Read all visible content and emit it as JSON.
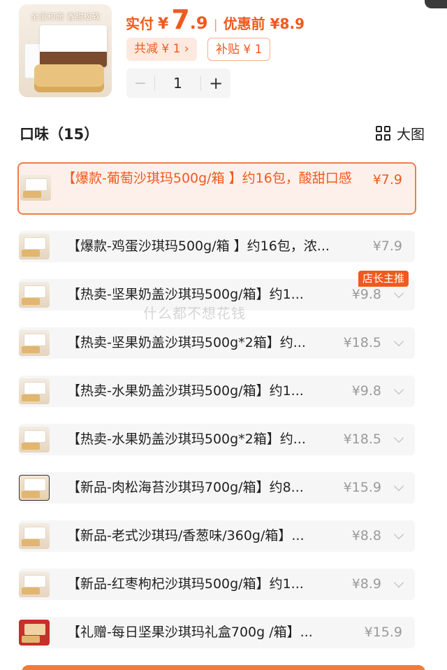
{
  "header": {
    "product_tag": "全蛋和面 香甜松软",
    "price_label": "实付",
    "currency": "¥",
    "price_int": "7",
    "price_dec": ".9",
    "separator": "|",
    "original_price": "优惠前 ¥8.9",
    "discount_chip": "共减 ¥ 1 ›",
    "subsidy_chip": "补贴 ¥ 1",
    "quantity": "1",
    "minus": "−",
    "plus": "+"
  },
  "section": {
    "title": "口味（15）",
    "view_toggle_label": "大图",
    "view_toggle_icon": "grid-icon"
  },
  "badge": "店长主推",
  "watermark": "什么都不想花钱",
  "options": [
    {
      "label": "【爆款-葡萄沙琪玛500g/箱 】约16包，酸甜口感",
      "price": "¥7.9"
    },
    {
      "label": "【爆款-鸡蛋沙琪玛500g/箱 】约16包，浓...",
      "price": "¥7.9"
    },
    {
      "label": "【热卖-坚果奶盖沙琪玛500g/箱】约1...",
      "price": "¥9.8"
    },
    {
      "label": "【热卖-坚果奶盖沙琪玛500g*2箱】约...",
      "price": "¥18.5"
    },
    {
      "label": "【热卖-水果奶盖沙琪玛500g/箱】约1...",
      "price": "¥9.8"
    },
    {
      "label": "【热卖-水果奶盖沙琪玛500g*2箱】约...",
      "price": "¥18.5"
    },
    {
      "label": "【新品-肉松海苔沙琪玛700g/箱】约8...",
      "price": "¥15.9"
    },
    {
      "label": "【新品-老式沙琪玛/香葱味/360g/箱】...",
      "price": "¥8.8"
    },
    {
      "label": "【新品-红枣枸杞沙琪玛500g/箱】约1...",
      "price": "¥8.9"
    },
    {
      "label": "【礼赠-每日坚果沙琪玛礼盒700g /箱】...",
      "price": "¥15.9"
    }
  ],
  "colors": {
    "accent": "#ef5a1f",
    "selected_bg": "#fdf0ea",
    "row_bg": "#f6f6f6"
  }
}
